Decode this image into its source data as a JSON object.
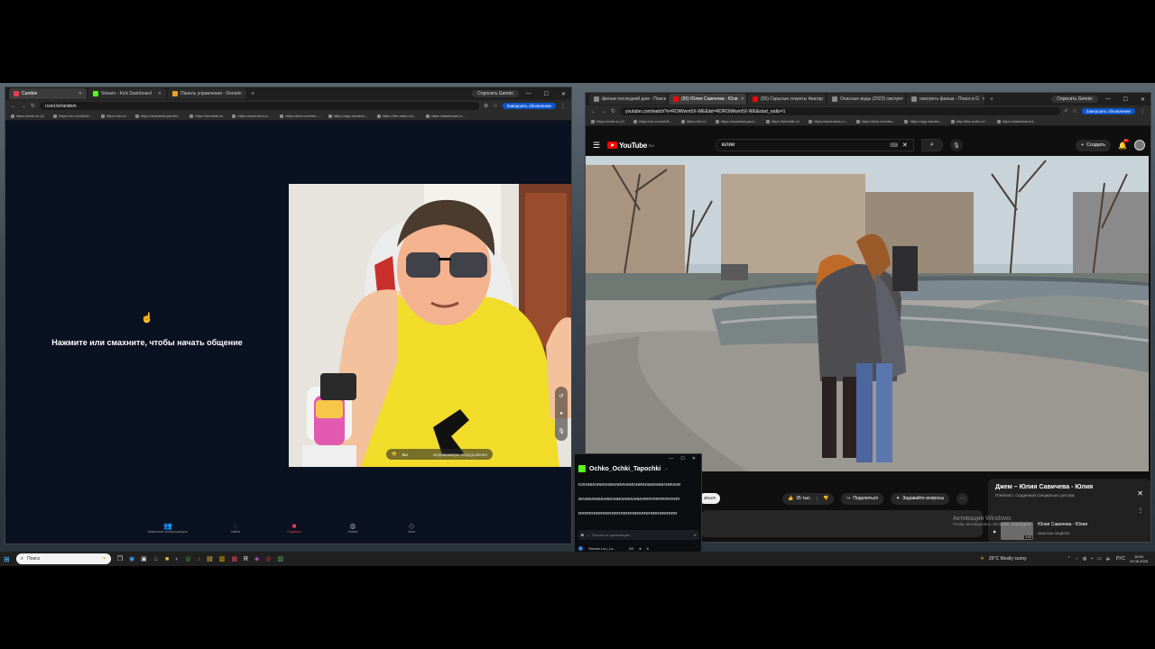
{
  "left_window": {
    "tabs": [
      {
        "label": "Cambie",
        "active": true,
        "color": "#e04050"
      },
      {
        "label": "Stream - Kick Dashboard",
        "active": false,
        "color": "#53fc18"
      },
      {
        "label": "Панель управления - Donatio",
        "active": false,
        "color": "#f0a020"
      }
    ],
    "gemini_label": "Спросить Gemini",
    "url": "ruvel.tv/random",
    "update_label": "Завершить обновление",
    "bookmarks": [
      "https://mail.ru/ (1)",
      "https://vk.com/id18...",
      "https://ok.ru/",
      "https://wordstat.yandex...",
      "https://kinoblik.ru/",
      "https://www.temu.c...",
      "https://kick.com/leo...",
      "https://app.wanteve...",
      "https://the-radio.ru/l...",
      "https://dashboard.d..."
    ],
    "chat_prompt": "Нажмите или смахните, чтобы начать общение",
    "overlay_left": "Вы",
    "overlay_right": "медиакамеры оборудования",
    "bottom_nav": [
      "Изменение интересующего",
      "Найти",
      "Подписка",
      "Новый",
      "Чаты"
    ]
  },
  "right_window": {
    "tabs": [
      {
        "label": "фильм последний дом - Поиск",
        "active": false,
        "color": "#888"
      },
      {
        "label": "(95) Юлия Савичева - Юли",
        "active": true,
        "color": "#ff0000"
      },
      {
        "label": "(95) Скрытые секреты Аватар",
        "active": false,
        "color": "#ff0000"
      },
      {
        "label": "Опасные воды (2023) смотрет",
        "active": false,
        "color": "#888"
      },
      {
        "label": "смотреть фильм - Поиск в G",
        "active": false,
        "color": "#888"
      }
    ],
    "gemini_label": "Спросить Gemini",
    "url": "youtube.com/watch?v=ROiWwm5X-WE&list=RDROiWwm5X-WE&start_radio=1",
    "update_label": "Завершить обновление",
    "bookmarks": [
      "https://mail.ru/ (1)",
      "https://vk.com/id18...",
      "https://ok.ru/",
      "https://wordstat.yand...",
      "https://kinobilk.ru/",
      "https://www.temu.c...",
      "https://kick.com/leo...",
      "https://app.wantev...",
      "http://the-radio.ru/...",
      "https://dashboard.d..."
    ],
    "yt_logo": "YouTube",
    "yt_region": "RU",
    "search_value": "юлии",
    "create_label": "Создать",
    "notif_count": "9+",
    "like_count": "35 тыс.",
    "share_label": "Поделиться",
    "ask_label": "Задавайте вопросы",
    "subscribe_partial": "аться",
    "playlist_title": "Джем – Юлия Савичева - Юлия",
    "playlist_sub": "Плейлист, созданный специально для вас",
    "playlist_item_title": "Юлия Савичева - Юлия",
    "playlist_item_artist": "МАКСИМ ФАДЕЕВ",
    "playlist_item_duration": "3:53",
    "activate_line1": "Активация Windows",
    "activate_line2": "Чтобы активировать Windows, перейдите"
  },
  "chat_window": {
    "channel": "Ochko_Ochki_Tapochki",
    "messages": [
      "ЮЛИИИИИИИИИИИИИИИИИИИИИИИИИИИИИИИИ",
      "ИИИИИИИИИИИИИИИИИИИИИИRRRRRRRRRRRR",
      "RRRRRRRRRRRRRRRRRRRRRRRRRRRRRRRRR"
    ],
    "input_placeholder": "Пишите в трансляцию...",
    "stream_name": "Stream Leo_La...",
    "stream_stats": "0/0",
    "viewers": "6"
  },
  "taskbar": {
    "search_placeholder": "Поиск",
    "weather": "26°C  Mostly sunny",
    "lang": "РУС",
    "time": "16:53",
    "date": "29.06.2025"
  },
  "colors": {
    "accent_blue": "#0b57d0",
    "kick_green": "#53fc18",
    "yt_red": "#ff0000",
    "shirt_yellow": "#f2dc2a"
  }
}
